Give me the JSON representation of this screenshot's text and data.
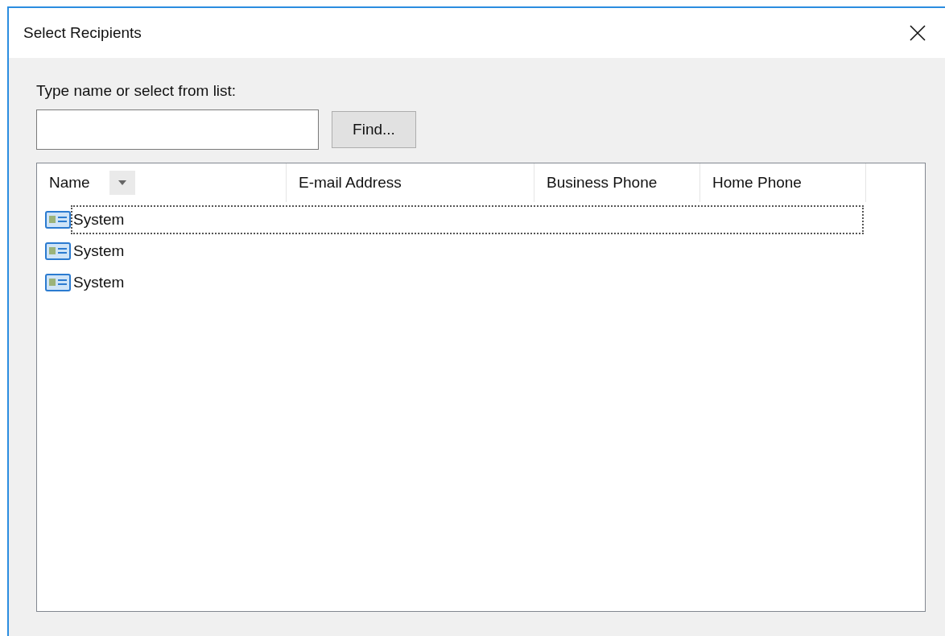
{
  "window": {
    "title": "Select Recipients"
  },
  "search": {
    "label": "Type name or select from list:"
  },
  "find_button": {
    "label": "Find..."
  },
  "table": {
    "columns": [
      {
        "label": "Name",
        "sortable_menu": true
      },
      {
        "label": "E-mail Address",
        "sortable_menu": false
      },
      {
        "label": "Business Phone",
        "sortable_menu": false
      },
      {
        "label": "Home Phone",
        "sortable_menu": false
      }
    ],
    "rows": [
      {
        "name": "System",
        "focused": true
      },
      {
        "name": "System",
        "focused": false
      },
      {
        "name": "System",
        "focused": false
      }
    ]
  }
}
